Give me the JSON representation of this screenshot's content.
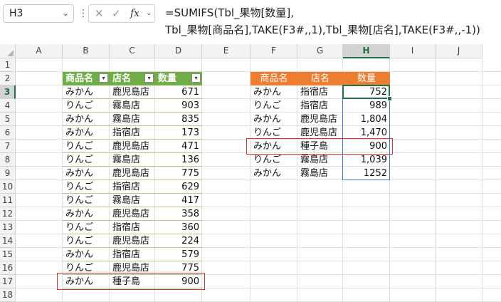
{
  "formula_bar": {
    "name_box": "H3",
    "fx_label": "fx",
    "formula_line1": "=SUMIFS(Tbl_果物[数量],",
    "formula_line2": "Tbl_果物[商品名],TAKE(F3#,,1),Tbl_果物[店名],TAKE(F3#,,-1))"
  },
  "columns": [
    "A",
    "B",
    "C",
    "D",
    "E",
    "F",
    "G",
    "H",
    "I",
    "J"
  ],
  "rows": [
    "1",
    "2",
    "3",
    "4",
    "5",
    "6",
    "7",
    "8",
    "9",
    "10",
    "11",
    "12",
    "13",
    "14",
    "15",
    "16",
    "17",
    "18"
  ],
  "left_table": {
    "headers": [
      "商品名",
      "店名",
      "数量"
    ],
    "rows": [
      [
        "みかん",
        "鹿児島店",
        "671"
      ],
      [
        "りんご",
        "霧島店",
        "903"
      ],
      [
        "みかん",
        "霧島店",
        "835"
      ],
      [
        "みかん",
        "指宿店",
        "173"
      ],
      [
        "りんご",
        "鹿児島店",
        "471"
      ],
      [
        "りんご",
        "霧島店",
        "136"
      ],
      [
        "みかん",
        "鹿児島店",
        "775"
      ],
      [
        "りんご",
        "指宿店",
        "629"
      ],
      [
        "りんご",
        "霧島店",
        "417"
      ],
      [
        "みかん",
        "鹿児島店",
        "358"
      ],
      [
        "りんご",
        "指宿店",
        "360"
      ],
      [
        "りんご",
        "鹿児島店",
        "224"
      ],
      [
        "みかん",
        "指宿店",
        "579"
      ],
      [
        "りんご",
        "鹿児島店",
        "775"
      ],
      [
        "みかん",
        "種子島",
        "900"
      ]
    ]
  },
  "right_table": {
    "headers": [
      "商品名",
      "店名",
      "数量"
    ],
    "rows": [
      [
        "みかん",
        "指宿店",
        "752"
      ],
      [
        "りんご",
        "指宿店",
        "989"
      ],
      [
        "みかん",
        "鹿児島店",
        "1,804"
      ],
      [
        "りんご",
        "鹿児島店",
        "1,470"
      ],
      [
        "みかん",
        "種子島",
        "900"
      ],
      [
        "りんご",
        "霧島店",
        "1,039"
      ],
      [
        "みかん",
        "霧島店",
        "1252"
      ]
    ]
  },
  "colors": {
    "left_header": "#70ad47",
    "right_header": "#ed7d31",
    "highlight_box": "#e03030",
    "selection": "#217346"
  }
}
